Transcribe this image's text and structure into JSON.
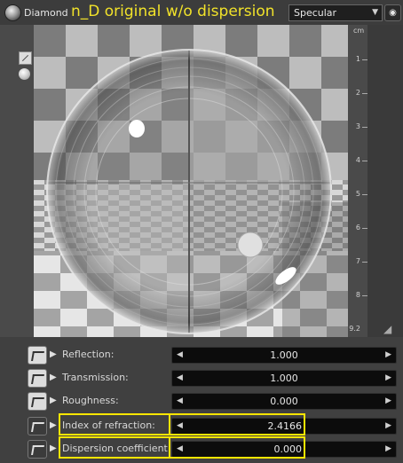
{
  "header": {
    "material_name": "Diamond",
    "overlay_title": "n_D original w/o dispersion",
    "shading_mode": "Specular"
  },
  "ruler": {
    "unit": "cm",
    "ticks": [
      "1",
      "2",
      "3",
      "4",
      "5",
      "6",
      "7",
      "8",
      "9.2"
    ]
  },
  "parameters": [
    {
      "label": "Reflection:",
      "value": "1.000"
    },
    {
      "label": "Transmission:",
      "value": "1.000"
    },
    {
      "label": "Roughness:",
      "value": "0.000"
    },
    {
      "label": "Index of refraction:",
      "value": "2.4166"
    },
    {
      "label": "Dispersion coefficient:",
      "value": "0.000"
    }
  ],
  "colors": {
    "highlight": "#ffe600",
    "overlay_text": "#f1e22a",
    "panel": "#404040"
  }
}
